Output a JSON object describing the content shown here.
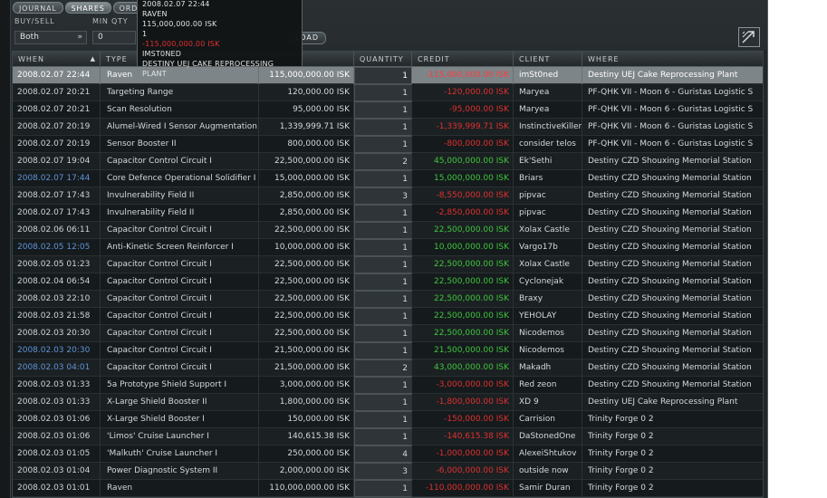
{
  "tabs": [
    {
      "label": "JOURNAL",
      "active": false
    },
    {
      "label": "SHARES",
      "active": true
    },
    {
      "label": "ORDERS",
      "active": false
    }
  ],
  "filters": {
    "buy_sell_label": "BUY/SELL",
    "buy_sell_value": "Both",
    "min_qty_label": "MIN QTY",
    "min_qty_value": "0",
    "load_label": "LOAD"
  },
  "tooltip": {
    "lines": [
      {
        "text": "2008.02.07 22:44",
        "negative": false
      },
      {
        "text": "RAVEN",
        "negative": false
      },
      {
        "text": "115,000,000.00 ISK",
        "negative": false
      },
      {
        "text": "1",
        "negative": false
      },
      {
        "text": "-115,000,000.00 ISK",
        "negative": true
      },
      {
        "text": "IMST0NED",
        "negative": false
      },
      {
        "text": "DESTINY UEJ CAKE REPROCESSING PLANT",
        "negative": false
      }
    ]
  },
  "columns": [
    {
      "key": "when",
      "label": "WHEN",
      "sorted": true
    },
    {
      "key": "type",
      "label": "TYPE",
      "sorted": false
    },
    {
      "key": "price",
      "label": "",
      "sorted": false
    },
    {
      "key": "qty",
      "label": "QUANTITY",
      "sorted": false
    },
    {
      "key": "credit",
      "label": "CREDIT",
      "sorted": false
    },
    {
      "key": "client",
      "label": "CLIENT",
      "sorted": false
    },
    {
      "key": "where",
      "label": "WHERE",
      "sorted": false
    }
  ],
  "rows": [
    {
      "when": "2008.02.07 22:44",
      "type": "Raven",
      "price": "115,000,000.00 ISK",
      "qty": "1",
      "credit": "-115,000,000.00 ISK",
      "client": "imSt0ned",
      "where": "Destiny UEJ Cake Reprocessing Plant",
      "blue": false,
      "selected": true
    },
    {
      "when": "2008.02.07 20:21",
      "type": "Targeting Range",
      "price": "120,000.00 ISK",
      "qty": "1",
      "credit": "-120,000.00 ISK",
      "client": "Maryea",
      "where": "PF-QHK VII - Moon 6 - Guristas Logistic S",
      "blue": false,
      "selected": false
    },
    {
      "when": "2008.02.07 20:21",
      "type": "Scan Resolution",
      "price": "95,000.00 ISK",
      "qty": "1",
      "credit": "-95,000.00 ISK",
      "client": "Maryea",
      "where": "PF-QHK VII - Moon 6 - Guristas Logistic S",
      "blue": false,
      "selected": false
    },
    {
      "when": "2008.02.07 20:19",
      "type": "Alumel-Wired I Sensor Augmentation",
      "price": "1,339,999.71 ISK",
      "qty": "1",
      "credit": "-1,339,999.71 ISK",
      "client": "InstinctiveKiller",
      "where": "PF-QHK VII - Moon 6 - Guristas Logistic S",
      "blue": false,
      "selected": false
    },
    {
      "when": "2008.02.07 20:19",
      "type": "Sensor Booster II",
      "price": "800,000.00 ISK",
      "qty": "1",
      "credit": "-800,000.00 ISK",
      "client": "consider telos",
      "where": "PF-QHK VII - Moon 6 - Guristas Logistic S",
      "blue": false,
      "selected": false
    },
    {
      "when": "2008.02.07 19:04",
      "type": "Capacitor Control Circuit I",
      "price": "22,500,000.00 ISK",
      "qty": "2",
      "credit": "45,000,000.00 ISK",
      "client": "Ek'Sethi",
      "where": "Destiny CZD Shouxing Memorial Station",
      "blue": false,
      "selected": false
    },
    {
      "when": "2008.02.07 17:44",
      "type": "Core Defence Operational Solidifier I",
      "price": "15,000,000.00 ISK",
      "qty": "1",
      "credit": "15,000,000.00 ISK",
      "client": "Briars",
      "where": "Destiny CZD Shouxing Memorial Station",
      "blue": true,
      "selected": false
    },
    {
      "when": "2008.02.07 17:43",
      "type": "Invulnerability Field II",
      "price": "2,850,000.00 ISK",
      "qty": "3",
      "credit": "-8,550,000.00 ISK",
      "client": "pipvac",
      "where": "Destiny CZD Shouxing Memorial Station",
      "blue": false,
      "selected": false
    },
    {
      "when": "2008.02.07 17:43",
      "type": "Invulnerability Field II",
      "price": "2,850,000.00 ISK",
      "qty": "1",
      "credit": "-2,850,000.00 ISK",
      "client": "pipvac",
      "where": "Destiny CZD Shouxing Memorial Station",
      "blue": false,
      "selected": false
    },
    {
      "when": "2008.02.06 06:11",
      "type": "Capacitor Control Circuit I",
      "price": "22,500,000.00 ISK",
      "qty": "1",
      "credit": "22,500,000.00 ISK",
      "client": "Xolax Castle",
      "where": "Destiny CZD Shouxing Memorial Station",
      "blue": false,
      "selected": false
    },
    {
      "when": "2008.02.05 12:05",
      "type": "Anti-Kinetic Screen Reinforcer I",
      "price": "10,000,000.00 ISK",
      "qty": "1",
      "credit": "10,000,000.00 ISK",
      "client": "Vargo17b",
      "where": "Destiny CZD Shouxing Memorial Station",
      "blue": true,
      "selected": false
    },
    {
      "when": "2008.02.05 01:23",
      "type": "Capacitor Control Circuit I",
      "price": "22,500,000.00 ISK",
      "qty": "1",
      "credit": "22,500,000.00 ISK",
      "client": "Xolax Castle",
      "where": "Destiny CZD Shouxing Memorial Station",
      "blue": false,
      "selected": false
    },
    {
      "when": "2008.02.04 06:54",
      "type": "Capacitor Control Circuit I",
      "price": "22,500,000.00 ISK",
      "qty": "1",
      "credit": "22,500,000.00 ISK",
      "client": "Cyclonejak",
      "where": "Destiny CZD Shouxing Memorial Station",
      "blue": false,
      "selected": false
    },
    {
      "when": "2008.02.03 22:10",
      "type": "Capacitor Control Circuit I",
      "price": "22,500,000.00 ISK",
      "qty": "1",
      "credit": "22,500,000.00 ISK",
      "client": "Braxy",
      "where": "Destiny CZD Shouxing Memorial Station",
      "blue": false,
      "selected": false
    },
    {
      "when": "2008.02.03 21:58",
      "type": "Capacitor Control Circuit I",
      "price": "22,500,000.00 ISK",
      "qty": "1",
      "credit": "22,500,000.00 ISK",
      "client": "YEHOLAY",
      "where": "Destiny CZD Shouxing Memorial Station",
      "blue": false,
      "selected": false
    },
    {
      "when": "2008.02.03 20:30",
      "type": "Capacitor Control Circuit I",
      "price": "22,500,000.00 ISK",
      "qty": "1",
      "credit": "22,500,000.00 ISK",
      "client": "Nicodemos",
      "where": "Destiny CZD Shouxing Memorial Station",
      "blue": false,
      "selected": false
    },
    {
      "when": "2008.02.03 20:30",
      "type": "Capacitor Control Circuit I",
      "price": "21,500,000.00 ISK",
      "qty": "1",
      "credit": "21,500,000.00 ISK",
      "client": "Nicodemos",
      "where": "Destiny CZD Shouxing Memorial Station",
      "blue": true,
      "selected": false
    },
    {
      "when": "2008.02.03 04:01",
      "type": "Capacitor Control Circuit I",
      "price": "21,500,000.00 ISK",
      "qty": "2",
      "credit": "43,000,000.00 ISK",
      "client": "Makadh",
      "where": "Destiny CZD Shouxing Memorial Station",
      "blue": true,
      "selected": false
    },
    {
      "when": "2008.02.03 01:33",
      "type": "5a Prototype Shield Support I",
      "price": "3,000,000.00 ISK",
      "qty": "1",
      "credit": "-3,000,000.00 ISK",
      "client": "Red zeon",
      "where": "Destiny CZD Shouxing Memorial Station",
      "blue": false,
      "selected": false
    },
    {
      "when": "2008.02.03 01:33",
      "type": "X-Large Shield Booster II",
      "price": "1,800,000.00 ISK",
      "qty": "1",
      "credit": "-1,800,000.00 ISK",
      "client": "XD 9",
      "where": "Destiny UEJ Cake Reprocessing Plant",
      "blue": false,
      "selected": false
    },
    {
      "when": "2008.02.03 01:06",
      "type": "X-Large Shield Booster I",
      "price": "150,000.00 ISK",
      "qty": "1",
      "credit": "-150,000.00 ISK",
      "client": "Carrision",
      "where": "Trinity Forge 0 2",
      "blue": false,
      "selected": false
    },
    {
      "when": "2008.02.03 01:06",
      "type": "'Limos' Cruise Launcher I",
      "price": "140,615.38 ISK",
      "qty": "1",
      "credit": "-140,615.38 ISK",
      "client": "DaStonedOne",
      "where": "Trinity Forge 0 2",
      "blue": false,
      "selected": false
    },
    {
      "when": "2008.02.03 01:05",
      "type": "'Malkuth' Cruise Launcher I",
      "price": "250,000.00 ISK",
      "qty": "4",
      "credit": "-1,000,000.00 ISK",
      "client": "AlexeiShtukov",
      "where": "Trinity Forge 0 2",
      "blue": false,
      "selected": false
    },
    {
      "when": "2008.02.03 01:04",
      "type": "Power Diagnostic System II",
      "price": "2,000,000.00 ISK",
      "qty": "3",
      "credit": "-6,000,000.00 ISK",
      "client": "outside now",
      "where": "Trinity Forge 0 2",
      "blue": false,
      "selected": false
    },
    {
      "when": "2008.02.03 01:01",
      "type": "Raven",
      "price": "110,000,000.00 ISK",
      "qty": "1",
      "credit": "-110,000,000.00 ISK",
      "client": "Samir Duran",
      "where": "Trinity Forge 0 2",
      "blue": false,
      "selected": false
    }
  ],
  "colors": {
    "positive": "#3ec53e",
    "negative": "#e03030",
    "date_highlight": "#5f93d6",
    "selected_row": "#7e8588"
  },
  "icons": {
    "dropdown": "chevron-down-icon",
    "export": "export-icon",
    "sort": "sort-ascending-icon"
  }
}
